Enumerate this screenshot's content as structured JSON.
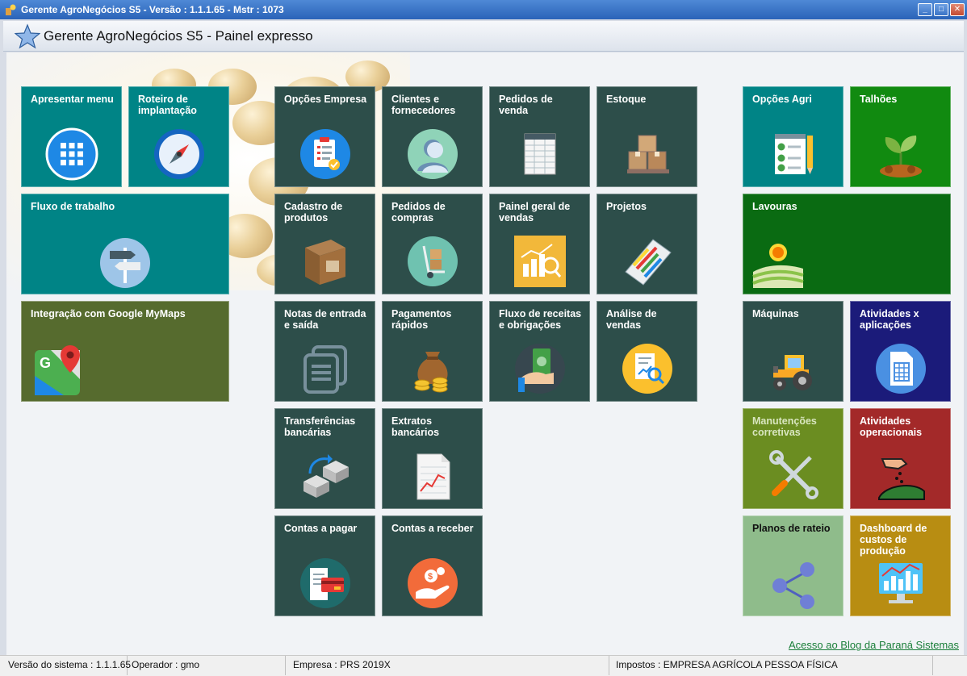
{
  "window": {
    "title": "Gerente AgroNegócios S5 -  Versão : 1.1.1.65 - Mstr : 1073"
  },
  "header": {
    "title": "Gerente AgroNegócios S5 - Painel expresso"
  },
  "tiles": {
    "apresentar_menu": "Apresentar menu",
    "roteiro": "Roteiro de implantação",
    "fluxo_trabalho": "Fluxo de trabalho",
    "google_mymaps": "Integração com Google MyMaps",
    "opcoes_empresa": "Opções Empresa",
    "clientes": "Clientes e fornecedores",
    "pedidos_venda": "Pedidos de venda",
    "estoque": "Estoque",
    "cadastro_produtos": "Cadastro de produtos",
    "pedidos_compras": "Pedidos de compras",
    "painel_vendas": "Painel geral de vendas",
    "projetos": "Projetos",
    "notas": "Notas de entrada e saída",
    "pagamentos": "Pagamentos rápidos",
    "fluxo_receitas": "Fluxo de receitas e obrigações",
    "analise_vendas": "Análise de vendas",
    "transferencias": "Transferências bancárias",
    "extratos": "Extratos bancários",
    "contas_pagar": "Contas a pagar",
    "contas_receber": "Contas a receber",
    "opcoes_agri": "Opções Agri",
    "talhoes": "Talhões",
    "lavouras": "Lavouras",
    "maquinas": "Máquinas",
    "atividades_aplicacoes": "Atividades x aplicações",
    "manutencoes": "Manutenções corretivas",
    "atividades_operacionais": "Atividades operacionais",
    "planos_rateio": "Planos de rateio",
    "dashboard_custos": "Dashboard de custos de produção"
  },
  "blog_link": "Acesso ao Blog da Paraná Sistemas",
  "status": {
    "versao": "Versão do sistema : 1.1.1.65",
    "operador": "Operador : gmo",
    "empresa": "Empresa : PRS 2019X",
    "impostos": "Impostos : EMPRESA AGRÍCOLA PESSOA FÍSICA"
  }
}
